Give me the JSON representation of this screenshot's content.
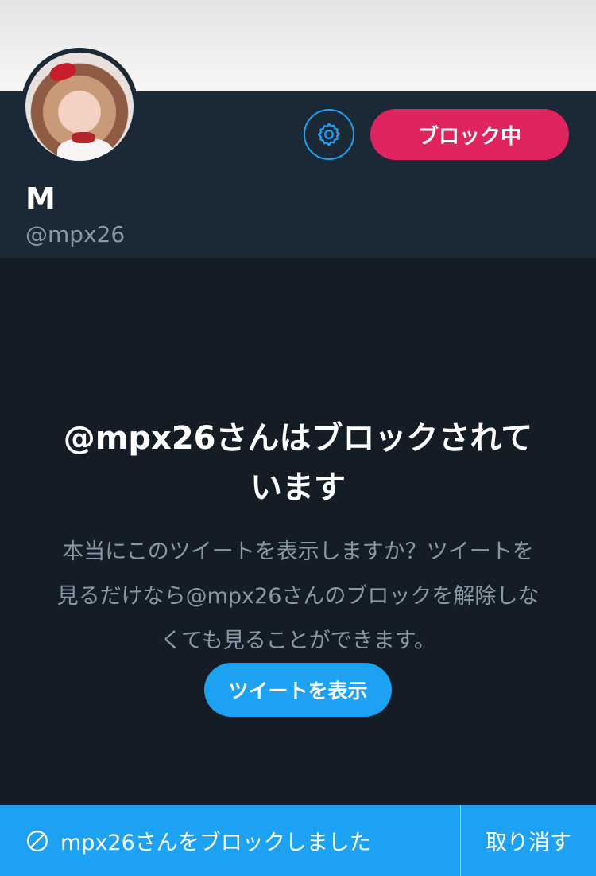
{
  "profile": {
    "display_name": "M",
    "handle": "@mpx26",
    "blocked_button_label": "ブロック中"
  },
  "blocked_notice": {
    "title": "@mpx26さんはブロックされています",
    "description": "本当にこのツイートを表示しますか？ツイートを見るだけなら@mpx26さんのブロックを解除しなくても見ることができます。",
    "view_button_label": "ツイートを表示"
  },
  "toast": {
    "message": "mpx26さんをブロックしました",
    "undo_label": "取り消す"
  },
  "icons": {
    "settings": "gear-icon",
    "block": "block-icon"
  },
  "colors": {
    "accent": "#1da1f2",
    "danger": "#e0245e",
    "background": "#141d26",
    "header_background": "#1b2836",
    "secondary_text": "#8899a6"
  }
}
